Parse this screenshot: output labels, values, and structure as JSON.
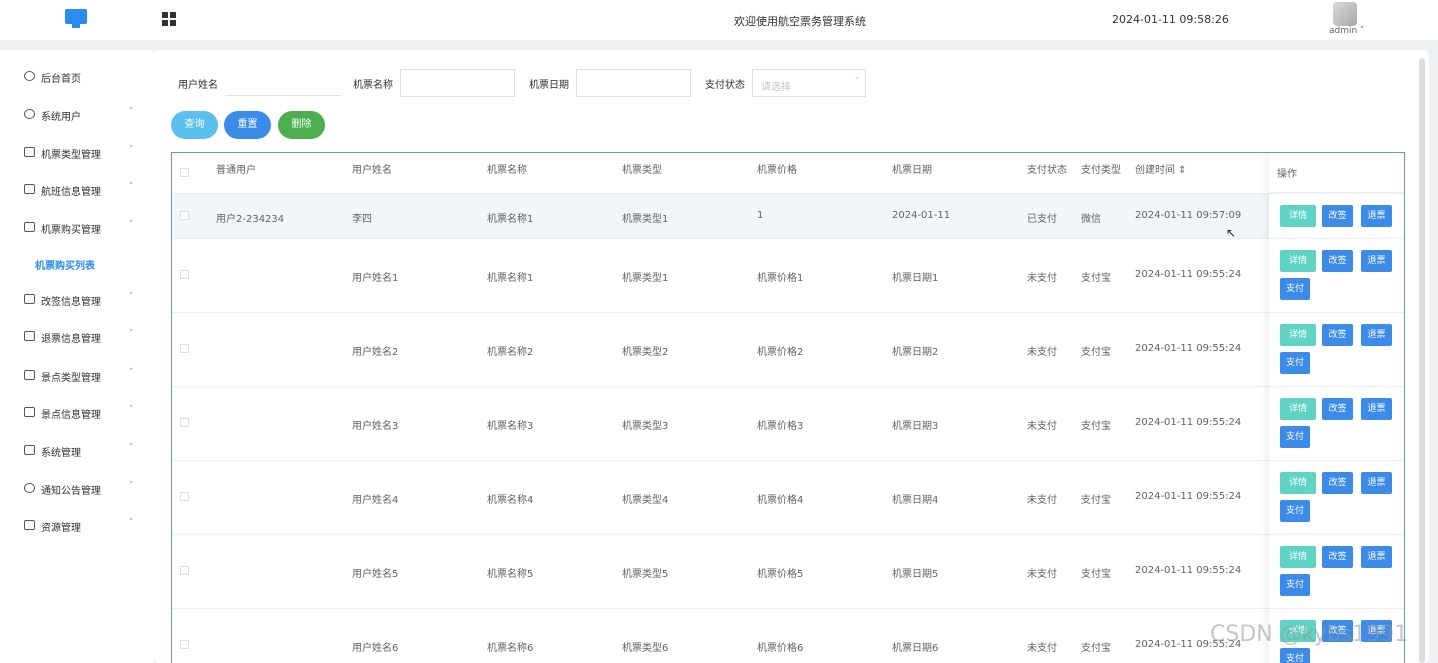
{
  "header": {
    "welcome": "欢迎使用航空票务管理系统",
    "datetime": "2024-01-11 09:58:26",
    "user": "admin ˅"
  },
  "sidebar": {
    "items": [
      {
        "label": "后台首页",
        "icon": "clock-icon",
        "arrow": ""
      },
      {
        "label": "系统用户",
        "icon": "user-icon",
        "arrow": "˅"
      },
      {
        "label": "机票类型管理",
        "icon": "card-icon",
        "arrow": "˅"
      },
      {
        "label": "航班信息管理",
        "icon": "card-icon",
        "arrow": "˅"
      },
      {
        "label": "机票购买管理",
        "icon": "card-icon",
        "arrow": "˄"
      },
      {
        "label": "改签信息管理",
        "icon": "card-icon",
        "arrow": "˅"
      },
      {
        "label": "退票信息管理",
        "icon": "card-icon",
        "arrow": "˅"
      },
      {
        "label": "景点类型管理",
        "icon": "card-icon",
        "arrow": "˅"
      },
      {
        "label": "景点信息管理",
        "icon": "card-icon",
        "arrow": "˅"
      },
      {
        "label": "系统管理",
        "icon": "folder-icon",
        "arrow": "˅"
      },
      {
        "label": "通知公告管理",
        "icon": "megaphone-icon",
        "arrow": "˅"
      },
      {
        "label": "资源管理",
        "icon": "printer-icon",
        "arrow": "˅"
      }
    ],
    "active_sub": "机票购买列表"
  },
  "filters": {
    "username_label": "用户姓名",
    "ticket_name_label": "机票名称",
    "ticket_date_label": "机票日期",
    "pay_status_label": "支付状态",
    "pay_status_placeholder": "请选择",
    "arrow": "˅"
  },
  "buttons": {
    "query": "查询",
    "reset": "重置",
    "delete": "删除"
  },
  "table": {
    "headers": [
      "普通用户",
      "用户姓名",
      "机票名称",
      "机票类型",
      "机票价格",
      "机票日期",
      "支付状态",
      "支付类型",
      "创建时间 ⇕"
    ],
    "op_header": "操作",
    "rows": [
      {
        "user": "用户2-234234",
        "name": "李四",
        "ticket": "机票名称1",
        "type": "机票类型1",
        "price": "1",
        "date": "2024-01-11",
        "status": "已支付",
        "paytype": "微信",
        "created": "2024-01-11 09:57:09"
      },
      {
        "user": "",
        "name": "用户姓名1",
        "ticket": "机票名称1",
        "type": "机票类型1",
        "price": "机票价格1",
        "date": "机票日期1",
        "status": "未支付",
        "paytype": "支付宝",
        "created": "2024-01-11 09:55:24"
      },
      {
        "user": "",
        "name": "用户姓名2",
        "ticket": "机票名称2",
        "type": "机票类型2",
        "price": "机票价格2",
        "date": "机票日期2",
        "status": "未支付",
        "paytype": "支付宝",
        "created": "2024-01-11 09:55:24"
      },
      {
        "user": "",
        "name": "用户姓名3",
        "ticket": "机票名称3",
        "type": "机票类型3",
        "price": "机票价格3",
        "date": "机票日期3",
        "status": "未支付",
        "paytype": "支付宝",
        "created": "2024-01-11 09:55:24"
      },
      {
        "user": "",
        "name": "用户姓名4",
        "ticket": "机票名称4",
        "type": "机票类型4",
        "price": "机票价格4",
        "date": "机票日期4",
        "status": "未支付",
        "paytype": "支付宝",
        "created": "2024-01-11 09:55:24"
      },
      {
        "user": "",
        "name": "用户姓名5",
        "ticket": "机票名称5",
        "type": "机票类型5",
        "price": "机票价格5",
        "date": "机票日期5",
        "status": "未支付",
        "paytype": "支付宝",
        "created": "2024-01-11 09:55:24"
      },
      {
        "user": "",
        "name": "用户姓名6",
        "ticket": "机票名称6",
        "type": "机票类型6",
        "price": "机票价格6",
        "date": "机票日期6",
        "status": "未支付",
        "paytype": "支付宝",
        "created": "2024-01-11 09:55:24"
      }
    ],
    "actions": {
      "detail": "详情",
      "edit": "改签",
      "refund": "退票",
      "pay": "支付"
    }
  },
  "watermark": "CSDN @kybs1991",
  "cursor": "↖"
}
